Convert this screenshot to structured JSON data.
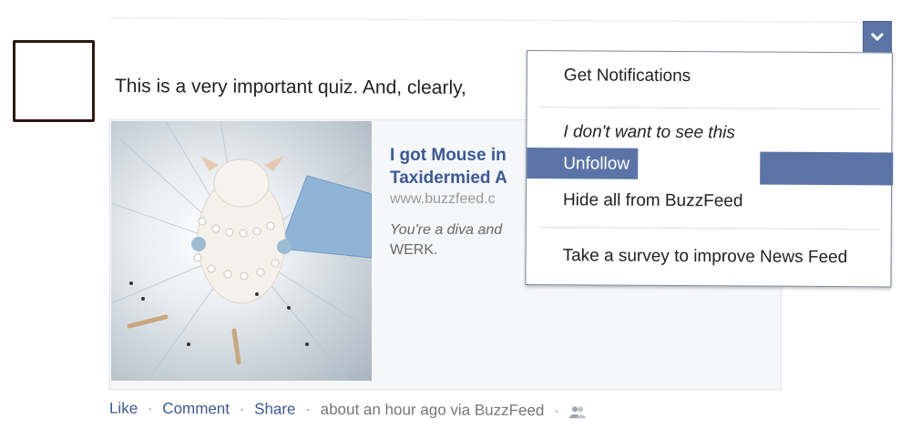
{
  "post": {
    "text": "This is a very important quiz. And, clearly,",
    "link_title": "I got Mouse in Taxidermied A",
    "link_domain": "www.buzzfeed.c",
    "link_desc_italic": "You're a diva and",
    "link_desc_rest": "WERK."
  },
  "menu": {
    "items": [
      {
        "label": "Get Notifications"
      },
      {
        "label": "I don't want to see this"
      },
      {
        "label": "Unfollow"
      },
      {
        "label": "Hide all from BuzzFeed"
      },
      {
        "label": "Take a survey to improve News Feed"
      }
    ]
  },
  "footer": {
    "like": "Like",
    "comment": "Comment",
    "share": "Share",
    "separator": "·",
    "meta": "about an hour ago via BuzzFeed"
  },
  "icons": {
    "menu_toggle": "chevron-down-icon",
    "audience": "friends-icon"
  },
  "colors": {
    "link": "#3b5998",
    "highlight": "#5b74a8"
  }
}
